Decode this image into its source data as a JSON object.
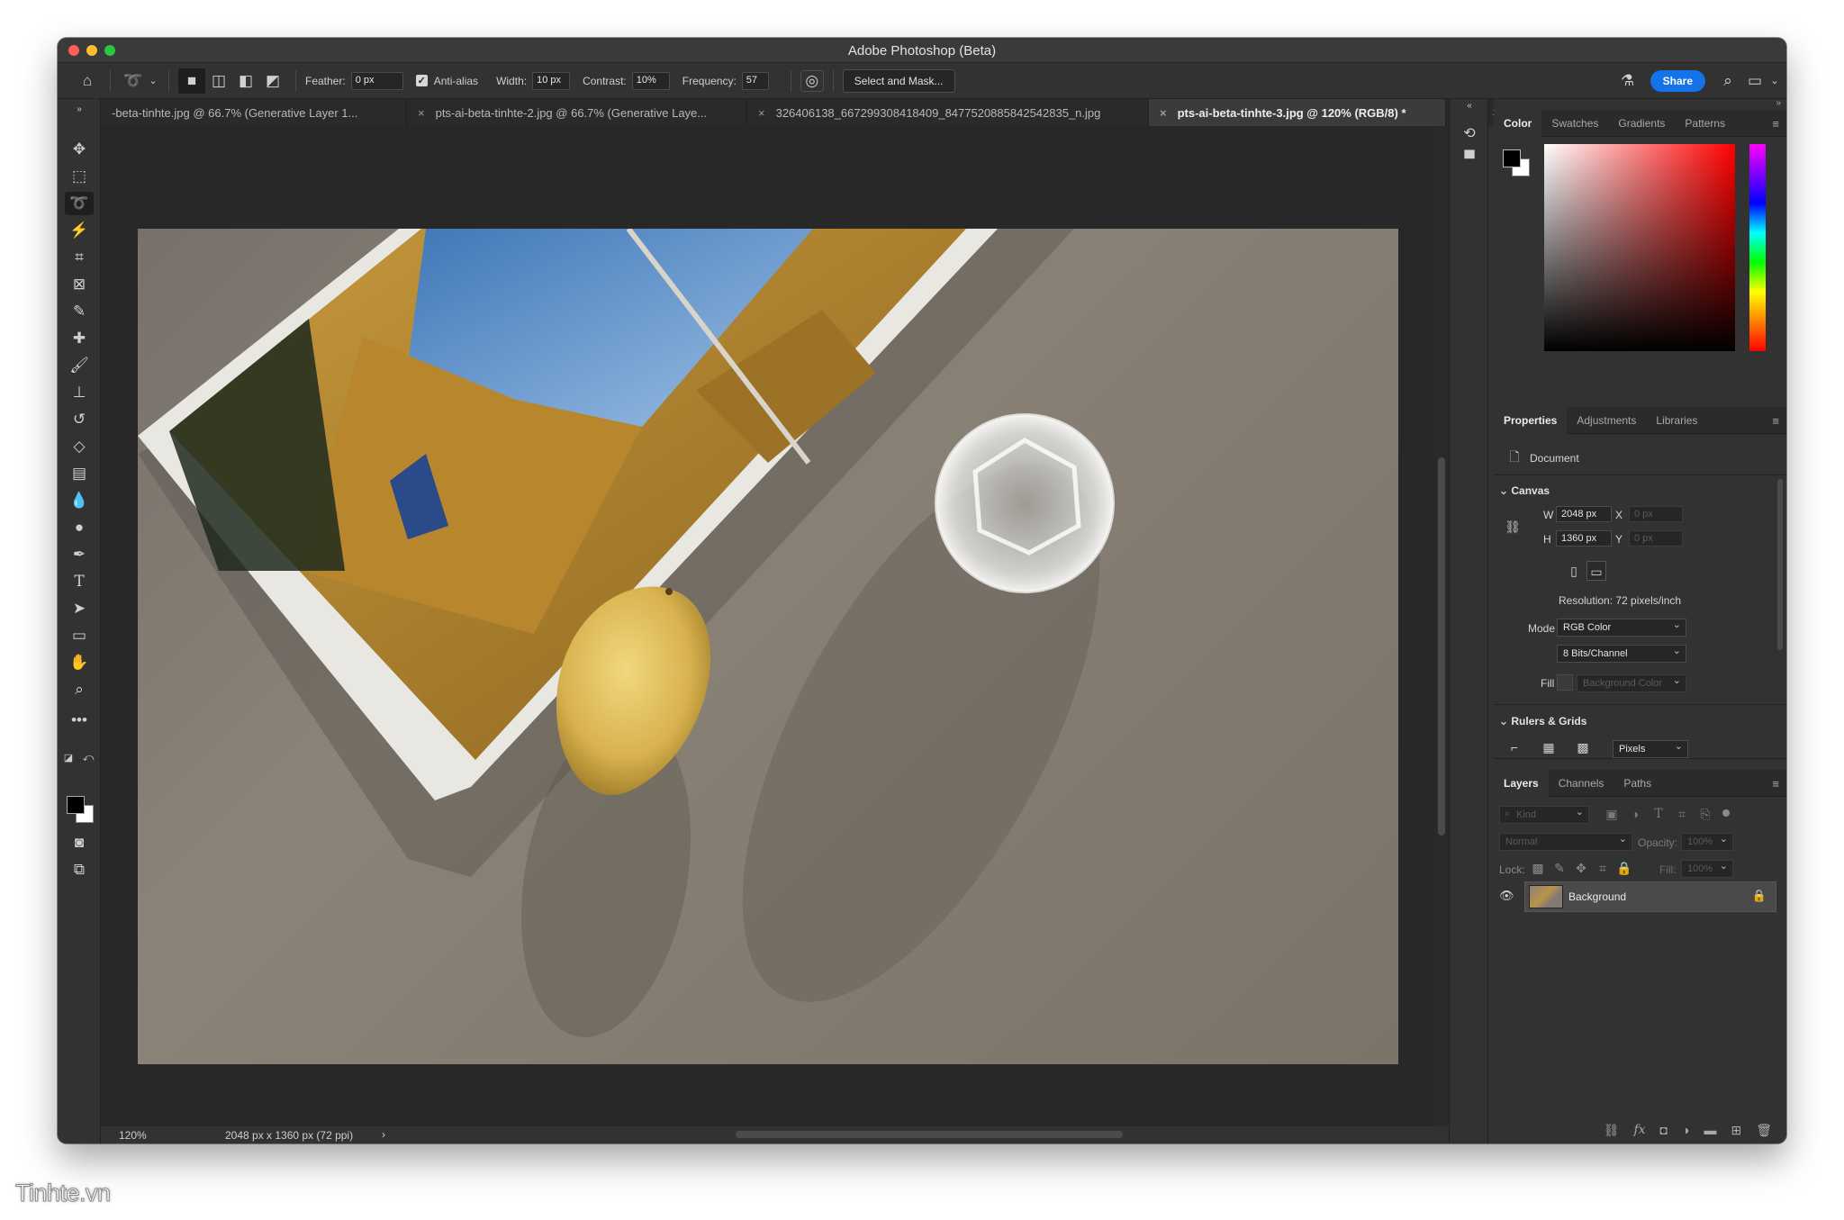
{
  "window": {
    "title": "Adobe Photoshop (Beta)"
  },
  "options_bar": {
    "feather_label": "Feather:",
    "feather_value": "0 px",
    "antialias_label": "Anti-alias",
    "width_label": "Width:",
    "width_value": "10 px",
    "contrast_label": "Contrast:",
    "contrast_value": "10%",
    "frequency_label": "Frequency:",
    "frequency_value": "57",
    "select_mask_label": "Select and Mask...",
    "share_label": "Share"
  },
  "tabs": [
    {
      "label": "-beta-tinhte.jpg @ 66.7% (Generative Layer 1...",
      "active": false
    },
    {
      "label": "pts-ai-beta-tinhte-2.jpg @ 66.7% (Generative Laye...",
      "active": false
    },
    {
      "label": "326406138_667299308418409_8477520885842542835_n.jpg",
      "active": false
    },
    {
      "label": "pts-ai-beta-tinhte-3.jpg @ 120% (RGB/8) *",
      "active": true
    }
  ],
  "status_bar": {
    "zoom": "120%",
    "dimensions": "2048 px x 1360 px (72 ppi)"
  },
  "color_panel": {
    "tabs": [
      "Color",
      "Swatches",
      "Gradients",
      "Patterns"
    ],
    "foreground": "#000000",
    "background": "#ffffff",
    "hue": "#ff0000"
  },
  "properties_panel": {
    "tabs": [
      "Properties",
      "Adjustments",
      "Libraries"
    ],
    "document_label": "Document",
    "canvas_label": "Canvas",
    "w_label": "W",
    "w_value": "2048 px",
    "h_label": "H",
    "h_value": "1360 px",
    "x_label": "X",
    "x_value": "0 px",
    "y_label": "Y",
    "y_value": "0 px",
    "resolution": "Resolution: 72 pixels/inch",
    "mode_label": "Mode",
    "mode_value": "RGB Color",
    "bits_value": "8 Bits/Channel",
    "fill_label": "Fill",
    "fill_value": "Background Color",
    "rulers_label": "Rulers & Grids",
    "units_value": "Pixels"
  },
  "layers_panel": {
    "tabs": [
      "Layers",
      "Channels",
      "Paths"
    ],
    "kind_placeholder": "Kind",
    "blend_mode": "Normal",
    "opacity_label": "Opacity:",
    "opacity_value": "100%",
    "lock_label": "Lock:",
    "fill_label": "Fill:",
    "fill_value": "100%",
    "layers": [
      {
        "name": "Background",
        "visible": true,
        "locked": true
      }
    ]
  },
  "watermark": "Tinhte.vn"
}
